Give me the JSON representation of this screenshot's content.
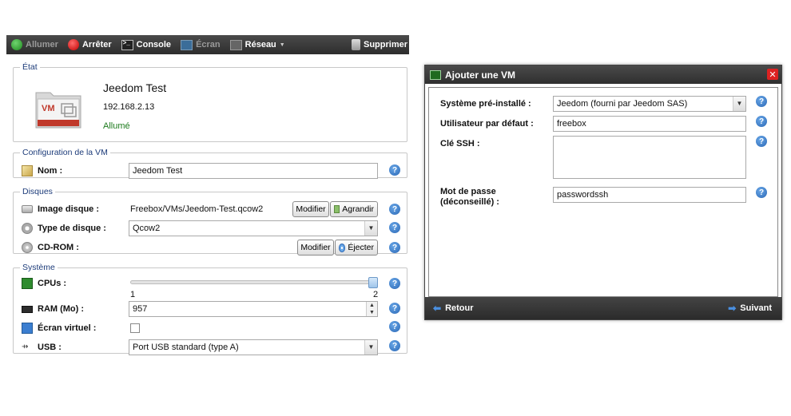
{
  "toolbar": {
    "start": "Allumer",
    "stop": "Arrêter",
    "console": "Console",
    "screen": "Écran",
    "network": "Réseau",
    "delete": "Supprimer"
  },
  "state": {
    "legend": "État",
    "icon_text": "VM",
    "vm_name": "Jeedom Test",
    "ip": "192.168.2.13",
    "status": "Allumé"
  },
  "config": {
    "legend": "Configuration de la VM",
    "name_label": "Nom :",
    "name_value": "Jeedom Test"
  },
  "disks": {
    "legend": "Disques",
    "image_label": "Image disque :",
    "image_value": "Freebox/VMs/Jeedom-Test.qcow2",
    "modify": "Modifier",
    "enlarge": "Agrandir",
    "type_label": "Type de disque :",
    "type_value": "Qcow2",
    "cdrom_label": "CD-ROM :",
    "eject": "Éjecter"
  },
  "system": {
    "legend": "Système",
    "cpus_label": "CPUs :",
    "cpu_min": "1",
    "cpu_max": "2",
    "cpu_value": 2,
    "ram_label": "RAM (Mo) :",
    "ram_value": "957",
    "vscreen_label": "Écran virtuel :",
    "usb_label": "USB :",
    "usb_value": "Port USB standard (type A)"
  },
  "help_glyph": "?",
  "dialog": {
    "title": "Ajouter une VM",
    "close": "✕",
    "preinstalled_label": "Système pré-installé :",
    "preinstalled_value": "Jeedom (fourni par Jeedom SAS)",
    "user_label": "Utilisateur par défaut :",
    "user_value": "freebox",
    "ssh_label": "Clé SSH :",
    "password_label_1": "Mot de passe",
    "password_label_2": "(déconseillé) :",
    "password_value": "passwordssh",
    "back": "Retour",
    "next": "Suivant"
  },
  "colors": {
    "accent": "#2a67b5",
    "status_on": "#1c7a1c",
    "toolbar": "#333333"
  }
}
